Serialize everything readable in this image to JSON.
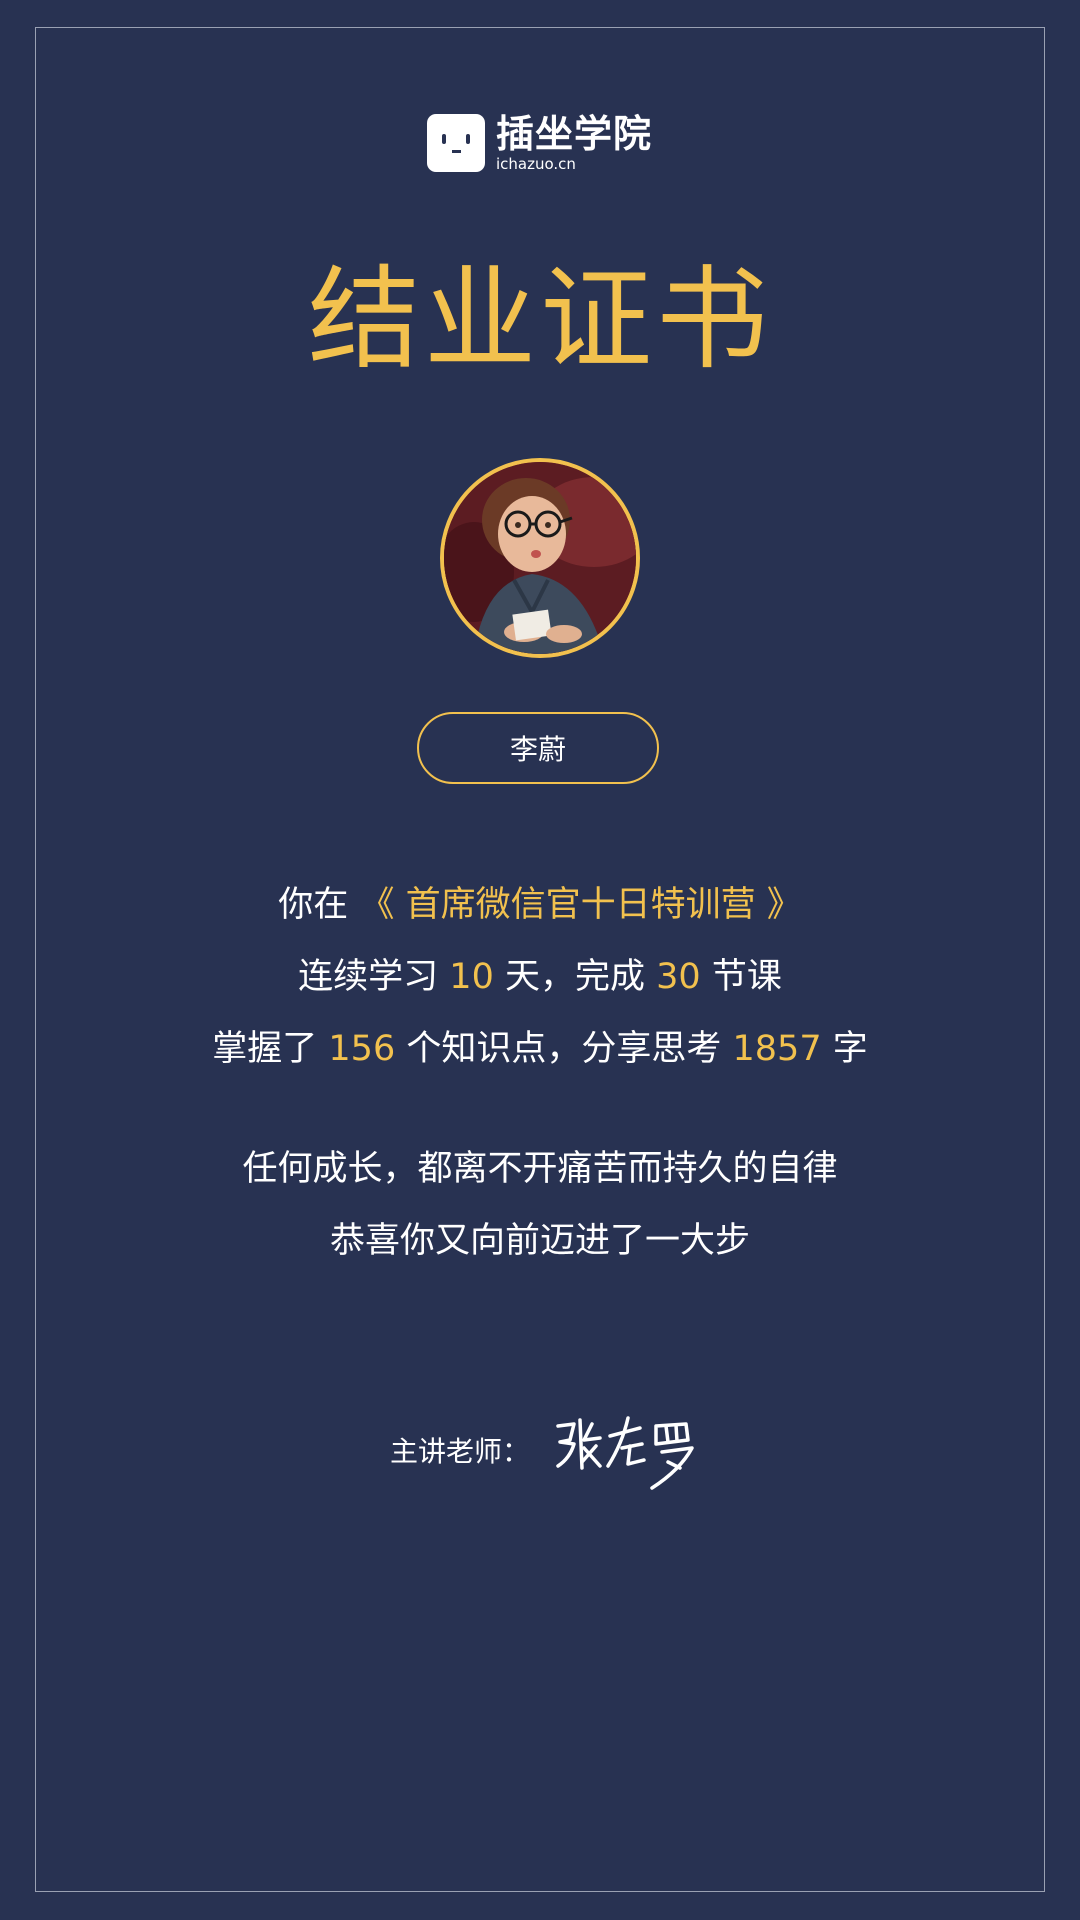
{
  "logo": {
    "name": "插坐学院",
    "domain": "ichazuo.cn"
  },
  "certificate": {
    "title": "结业证书",
    "student_name": "李蔚"
  },
  "summary": {
    "line1_prefix": "你在",
    "course": "《 首席微信官十日特训营 》",
    "line2_a": "连续学习",
    "days": "10",
    "line2_b": "天，完成",
    "lessons": "30",
    "line2_c": "节课",
    "line3_a": "掌握了",
    "knowledge_points": "156",
    "line3_b": "个知识点，分享思考",
    "words": "1857",
    "line3_c": "字"
  },
  "motto": {
    "line1": "任何成长，都离不开痛苦而持久的自律",
    "line2": "恭喜你又向前迈进了一大步"
  },
  "teacher": {
    "label": "主讲老师：",
    "signature": "张左罗"
  },
  "colors": {
    "background": "#283252",
    "accent": "#f2c14e",
    "text": "#ffffff",
    "frame": "#9aa1b3"
  }
}
